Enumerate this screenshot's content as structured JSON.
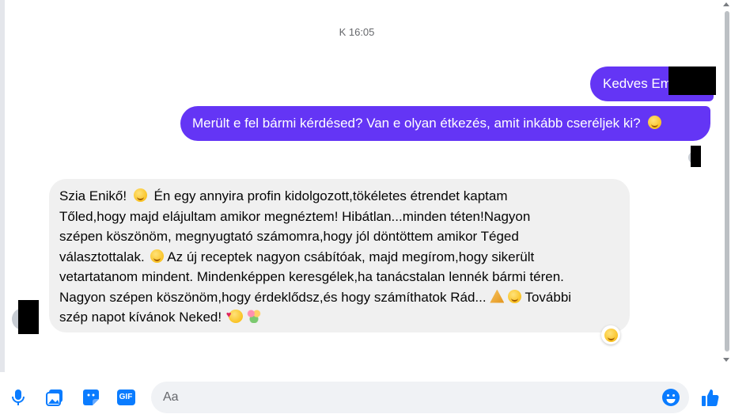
{
  "thread": {
    "timestamp": "K 16:05"
  },
  "sent_messages": [
    {
      "text": "Kedves Em"
    },
    {
      "text": "Merült e fel bármi kérdésed? Van e olyan étkezés, amit inkább cseréljek ki?"
    }
  ],
  "received_message": {
    "lines": [
      "Szia Enikő!",
      "Én egy annyira profin kidolgozott,tökéletes étrendet kaptam",
      "Tőled,hogy majd elájultam amikor megnéztem! Hibátlan...minden téten!Nagyon",
      "szépen köszönöm, megnyugtató számomra,hogy jól döntöttem amikor Téged",
      "választottalak.",
      "Az új receptek nagyon csábítóak, majd megírom,hogy sikerült",
      "vetartatanom mindent. Mindenképpen keresgélek,ha tanácstalan lennék bármi téren.",
      "Nagyon szépen köszönöm,hogy érdeklődsz,és hogy számíthatok Rád...",
      "További",
      "szép napot kívánok Neked!"
    ]
  },
  "composer": {
    "placeholder": "Aa"
  },
  "icons": {
    "mic": "microphone-icon",
    "gallery": "photo-gallery-icon",
    "sticker": "sticker-icon",
    "gif": "gif-icon",
    "emoji": "emoji-icon",
    "like": "thumbs-up-icon",
    "gif_label": "GIF"
  },
  "colors": {
    "sent_bubble": "#6435f5",
    "received_bubble": "#f0f0f0",
    "accent": "#0a7cff"
  }
}
